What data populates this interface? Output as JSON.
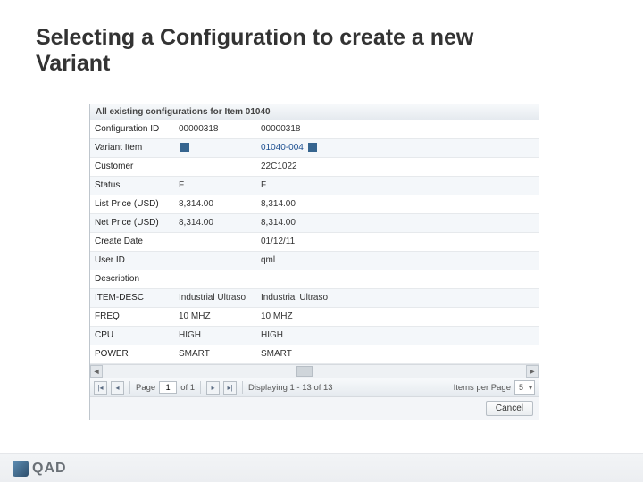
{
  "slide_title": "Selecting a Configuration to create a new Variant",
  "panel": {
    "title": "All existing configurations for Item 01040"
  },
  "rows": [
    {
      "label": "Configuration ID",
      "c1": "00000318",
      "c2": "00000318"
    },
    {
      "label": "Variant Item",
      "c1": "__LINKICON__",
      "c2": "01040-004 __LINKICON__"
    },
    {
      "label": "Customer",
      "c1": "",
      "c2": "22C1022"
    },
    {
      "label": "Status",
      "c1": "F",
      "c2": "F"
    },
    {
      "label": "List Price (USD)",
      "c1": "8,314.00",
      "c2": "8,314.00"
    },
    {
      "label": "Net Price (USD)",
      "c1": "8,314.00",
      "c2": "8,314.00"
    },
    {
      "label": "Create Date",
      "c1": "",
      "c2": "01/12/11"
    },
    {
      "label": "User ID",
      "c1": "",
      "c2": "qml"
    },
    {
      "label": "Description",
      "c1": "",
      "c2": ""
    },
    {
      "label": "ITEM-DESC",
      "c1": "Industrial Ultraso",
      "c2": "Industrial Ultraso"
    },
    {
      "label": "FREQ",
      "c1": "10 MHZ",
      "c2": "10 MHZ"
    },
    {
      "label": "CPU",
      "c1": "HIGH",
      "c2": "HIGH"
    },
    {
      "label": "POWER",
      "c1": "SMART",
      "c2": "SMART"
    }
  ],
  "pager": {
    "page_label": "Page",
    "page": "1",
    "of": "of 1",
    "display": "Displaying 1 - 13 of 13",
    "ipp_label": "Items per Page",
    "ipp_value": "5"
  },
  "cancel": "Cancel",
  "brand": "QAD"
}
